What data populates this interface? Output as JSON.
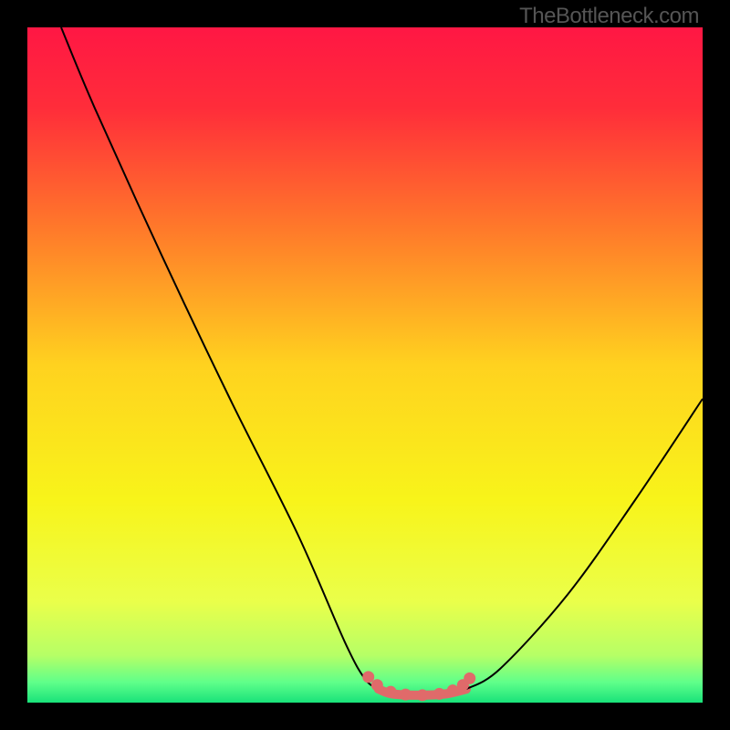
{
  "watermark": "TheBottleneck.com",
  "chart_data": {
    "type": "line",
    "title": "",
    "xlabel": "",
    "ylabel": "",
    "xlim": [
      0,
      100
    ],
    "ylim": [
      0,
      100
    ],
    "background": {
      "style": "vertical-gradient",
      "stops": [
        {
          "pos": 0.0,
          "color": "#ff1744"
        },
        {
          "pos": 0.12,
          "color": "#ff2d3a"
        },
        {
          "pos": 0.3,
          "color": "#ff7a2a"
        },
        {
          "pos": 0.5,
          "color": "#ffd21f"
        },
        {
          "pos": 0.7,
          "color": "#f8f41a"
        },
        {
          "pos": 0.85,
          "color": "#eaff4a"
        },
        {
          "pos": 0.93,
          "color": "#b6ff66"
        },
        {
          "pos": 0.97,
          "color": "#5fff8a"
        },
        {
          "pos": 1.0,
          "color": "#19e27a"
        }
      ]
    },
    "series": [
      {
        "name": "left-curve",
        "x": [
          5.0,
          10.0,
          20.0,
          30.0,
          40.0,
          47.0,
          50.0,
          52.0
        ],
        "y": [
          100.0,
          88.0,
          66.0,
          45.0,
          25.0,
          9.0,
          3.5,
          2.0
        ]
      },
      {
        "name": "right-curve",
        "x": [
          65.0,
          70.0,
          80.0,
          90.0,
          100.0
        ],
        "y": [
          2.0,
          5.0,
          16.0,
          30.0,
          45.0
        ]
      },
      {
        "name": "bottom-flat",
        "x": [
          52.0,
          54.0,
          58.0,
          62.0,
          65.0
        ],
        "y": [
          2.0,
          1.3,
          1.1,
          1.3,
          2.0
        ]
      }
    ],
    "marker_series": {
      "name": "bottom-markers",
      "color": "#e06a6a",
      "points": [
        {
          "x": 50.5,
          "y": 3.8
        },
        {
          "x": 51.8,
          "y": 2.6
        },
        {
          "x": 53.8,
          "y": 1.6
        },
        {
          "x": 56.0,
          "y": 1.2
        },
        {
          "x": 58.5,
          "y": 1.1
        },
        {
          "x": 61.0,
          "y": 1.3
        },
        {
          "x": 63.0,
          "y": 1.8
        },
        {
          "x": 64.5,
          "y": 2.6
        },
        {
          "x": 65.5,
          "y": 3.6
        }
      ]
    }
  }
}
